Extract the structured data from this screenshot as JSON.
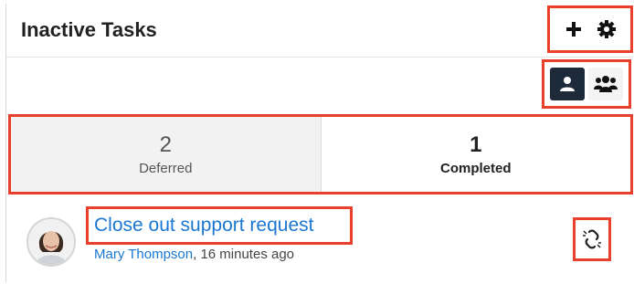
{
  "dashlet": {
    "title": "Inactive Tasks",
    "actions": {
      "add_icon": "plus-icon",
      "settings_icon": "gear-icon"
    }
  },
  "view_toggle": {
    "options": [
      {
        "icon": "single-user-icon",
        "active": true
      },
      {
        "icon": "group-users-icon",
        "active": false
      }
    ]
  },
  "tabs": [
    {
      "count": "2",
      "label": "Deferred",
      "selected": false
    },
    {
      "count": "1",
      "label": "Completed",
      "selected": true
    }
  ],
  "record": {
    "title": "Close out support request",
    "assigned_user": "Mary Thompson",
    "time_suffix": ", 16 minutes ago",
    "unlink_icon": "unlink-icon"
  },
  "colors": {
    "highlight": "#e8402a",
    "link": "#1b77d1",
    "toggle_active": "#1c2a39"
  }
}
